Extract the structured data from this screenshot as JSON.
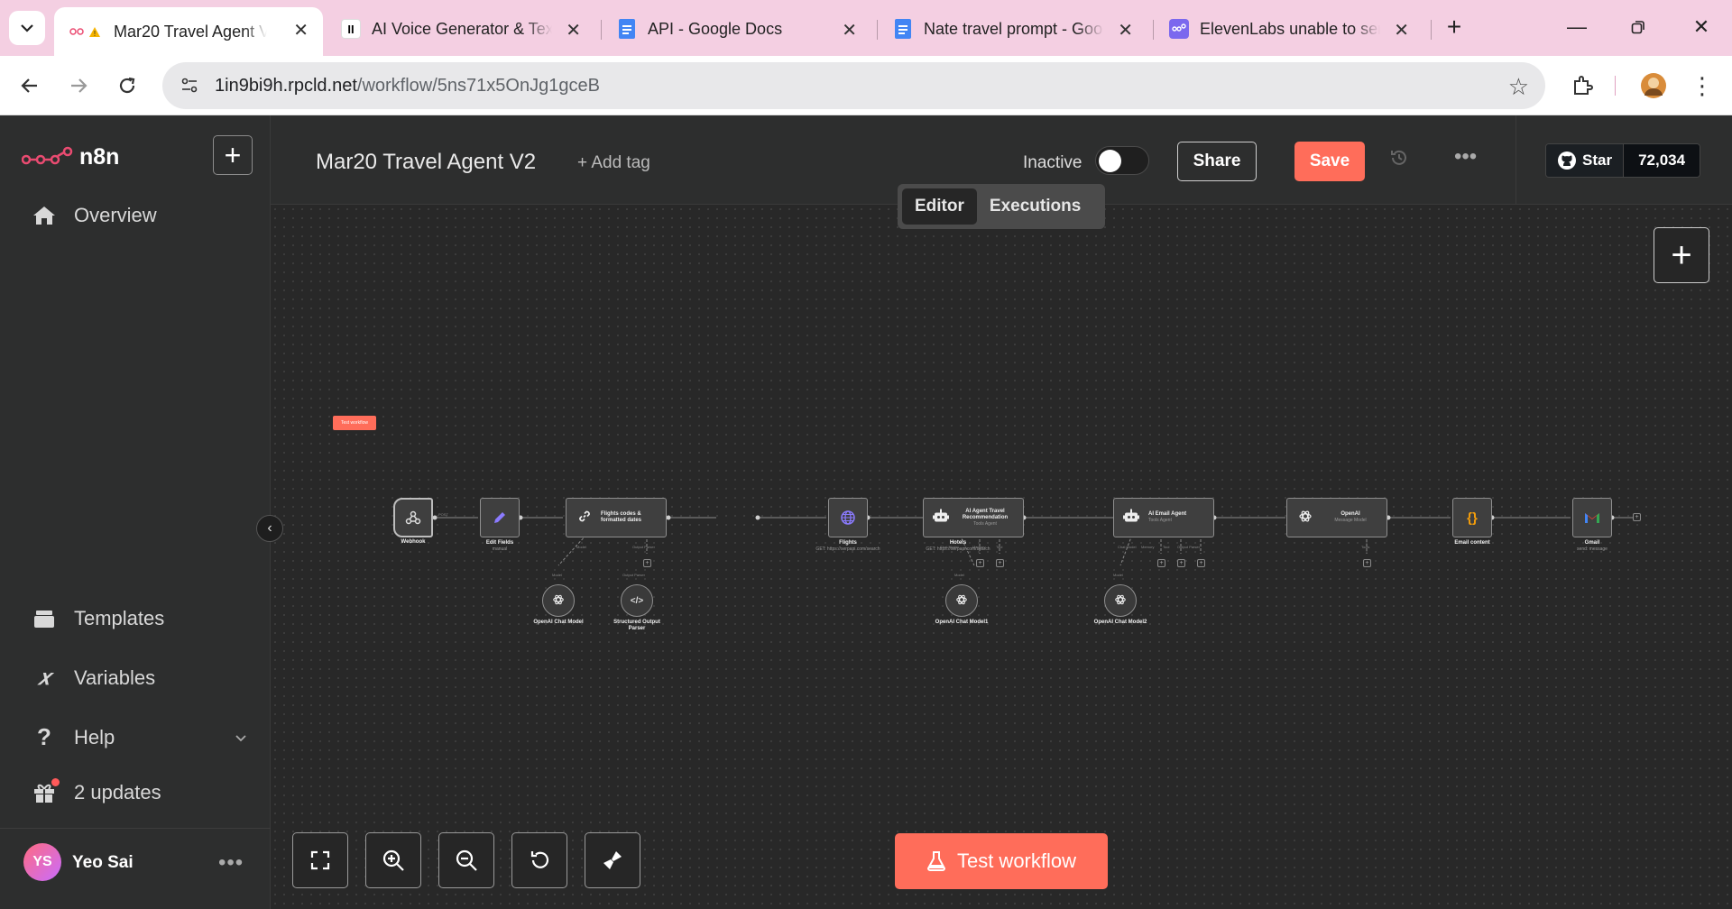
{
  "browser": {
    "tabs": [
      {
        "title": "Mar20 Travel Agent V",
        "icon": "n8n-warning-icon",
        "active": true
      },
      {
        "title": "AI Voice Generator & Tex",
        "icon": "elevenlabs-icon",
        "active": false
      },
      {
        "title": "API - Google Docs",
        "icon": "google-docs-icon",
        "active": false
      },
      {
        "title": "Nate travel prompt - Goo",
        "icon": "google-docs-icon",
        "active": false
      },
      {
        "title": "ElevenLabs unable to sen",
        "icon": "n8n-community-icon",
        "active": false
      }
    ],
    "url_host": "1in9bi9h.rpcld.net",
    "url_path": "/workflow/5ns71x5OnJg1gceB"
  },
  "app": {
    "logo_text": "n8n",
    "sidebar": {
      "overview": "Overview",
      "templates": "Templates",
      "variables": "Variables",
      "help": "Help",
      "updates": "2 updates",
      "user_initials": "YS",
      "user_name": "Yeo Sai"
    },
    "header": {
      "workflow_name": "Mar20 Travel Agent V2",
      "add_tag": "+ Add tag",
      "status": "Inactive",
      "share": "Share",
      "save": "Save",
      "github_star": "Star",
      "github_count": "72,034"
    },
    "view_tabs": {
      "editor": "Editor",
      "executions": "Executions"
    },
    "test_workflow": "Test workflow",
    "canvas": {
      "test_tag": "Test workflow",
      "nodes": {
        "webhook": "Webhook",
        "edit_fields": "Edit Fields",
        "edit_fields_sub": "manual",
        "flight_codes": "Flights codes & formatted dates",
        "flights": "Flights",
        "flights_sub": "GET: https://serpapi.com/search",
        "hotels": "Hotels",
        "hotels_sub": "GET: https://serpapi.com/search",
        "ai_agent_travel": "AI Agent Travel Recommendation",
        "ai_agent_travel_sub": "Tools Agent",
        "ai_email_agent": "AI Email Agent",
        "ai_email_agent_sub": "Tools Agent",
        "openai": "OpenAI",
        "openai_sub": "Message Model",
        "email_content": "Email content",
        "gmail": "Gmail",
        "gmail_sub": "send: message",
        "chat_model": "OpenAI Chat Model",
        "output_parser": "Structured Output Parser",
        "chat_model1": "OpenAI Chat Model1",
        "chat_model2": "OpenAI Chat Model2"
      },
      "ports": {
        "model": "Model",
        "output_parser": "Output Parser",
        "chat_model": "Chat Model",
        "memory": "Memory",
        "tool": "Tool",
        "tools": "Tools",
        "post": "POST"
      }
    }
  }
}
